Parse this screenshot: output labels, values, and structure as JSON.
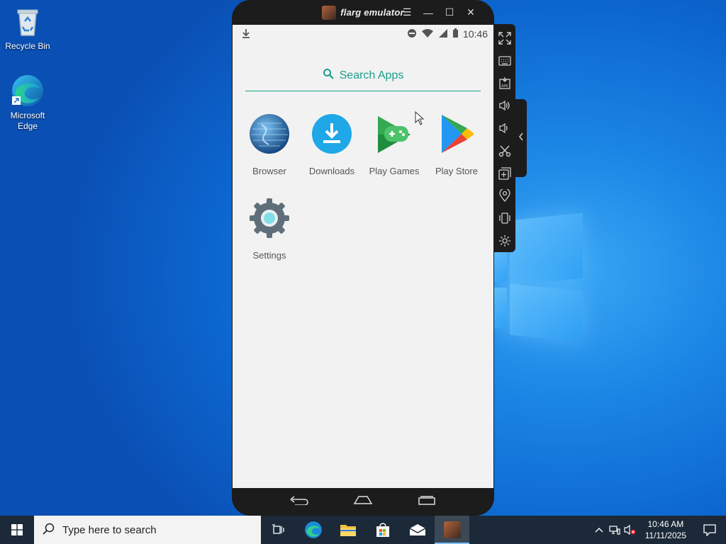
{
  "desktop": {
    "icons": [
      {
        "label": "Recycle Bin"
      },
      {
        "label": "Microsoft Edge"
      }
    ]
  },
  "emulator": {
    "title": "flarg emulator",
    "status": {
      "time": "10:46"
    },
    "search_label": "Search Apps",
    "apps": [
      {
        "label": "Browser"
      },
      {
        "label": "Downloads"
      },
      {
        "label": "Play Games"
      },
      {
        "label": "Play Store"
      },
      {
        "label": "Settings"
      }
    ],
    "toolbar": [
      "fullscreen-icon",
      "keyboard-icon",
      "apk-install-icon",
      "volume-up-icon",
      "volume-down-icon",
      "screenshot-icon",
      "multi-instance-icon",
      "location-icon",
      "shake-icon",
      "settings-icon"
    ]
  },
  "taskbar": {
    "search_placeholder": "Type here to search",
    "clock_time": "10:46 AM",
    "clock_date": "11/11/2025"
  },
  "colors": {
    "accent": "#18a08a",
    "taskbar": "#1b2938",
    "emulator_frame": "#1c1c1c"
  }
}
